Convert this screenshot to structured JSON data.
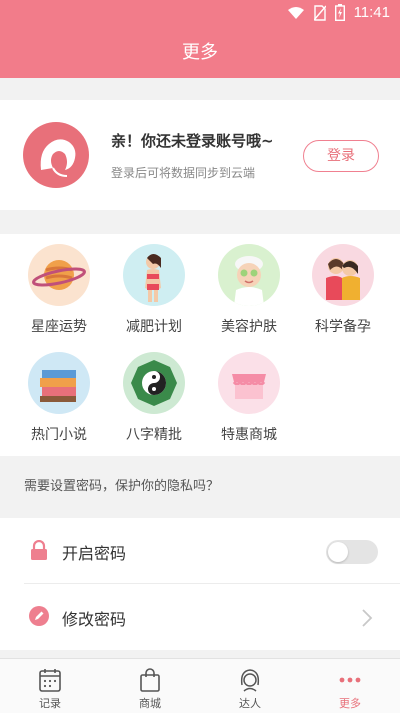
{
  "status_bar": {
    "time": "11:41"
  },
  "header": {
    "title": "更多"
  },
  "login": {
    "title": "亲！你还未登录账号哦~",
    "subtitle": "登录后可将数据同步到云端",
    "button": "登录"
  },
  "features": [
    {
      "label": "星座运势",
      "icon": "planet-icon",
      "bg": "#fbe3cf"
    },
    {
      "label": "减肥计划",
      "icon": "diet-woman-icon",
      "bg": "#cfeef2"
    },
    {
      "label": "美容护肤",
      "icon": "skincare-icon",
      "bg": "#d9f1cf"
    },
    {
      "label": "科学备孕",
      "icon": "couple-icon",
      "bg": "#f9d9e1"
    },
    {
      "label": "热门小说",
      "icon": "books-icon",
      "bg": "#cfe8f5"
    },
    {
      "label": "八字精批",
      "icon": "yinyang-icon",
      "bg": "#cde9d2"
    },
    {
      "label": "特惠商城",
      "icon": "shop-icon",
      "bg": "#fbe0e8"
    }
  ],
  "privacy": {
    "hint": "需要设置密码，保护你的隐私吗？",
    "enable_password": "开启密码",
    "enable_password_on": false,
    "change_password": "修改密码"
  },
  "tabbar": {
    "tabs": [
      {
        "label": "记录",
        "icon": "calendar-icon"
      },
      {
        "label": "商城",
        "icon": "shopping-bag-icon"
      },
      {
        "label": "达人",
        "icon": "woman-face-icon"
      },
      {
        "label": "更多",
        "icon": "more-dots-icon"
      }
    ],
    "active": "更多"
  },
  "colors": {
    "brand": "#f27c8a",
    "accent": "#e8707a",
    "toggle_off": "#e4e4e4"
  }
}
